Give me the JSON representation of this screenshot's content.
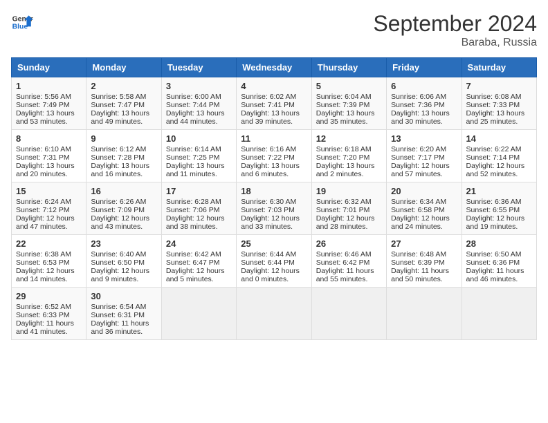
{
  "header": {
    "logo_line1": "General",
    "logo_line2": "Blue",
    "title": "September 2024",
    "subtitle": "Baraba, Russia"
  },
  "weekdays": [
    "Sunday",
    "Monday",
    "Tuesday",
    "Wednesday",
    "Thursday",
    "Friday",
    "Saturday"
  ],
  "weeks": [
    [
      {
        "day": "1",
        "lines": [
          "Sunrise: 5:56 AM",
          "Sunset: 7:49 PM",
          "Daylight: 13 hours",
          "and 53 minutes."
        ]
      },
      {
        "day": "2",
        "lines": [
          "Sunrise: 5:58 AM",
          "Sunset: 7:47 PM",
          "Daylight: 13 hours",
          "and 49 minutes."
        ]
      },
      {
        "day": "3",
        "lines": [
          "Sunrise: 6:00 AM",
          "Sunset: 7:44 PM",
          "Daylight: 13 hours",
          "and 44 minutes."
        ]
      },
      {
        "day": "4",
        "lines": [
          "Sunrise: 6:02 AM",
          "Sunset: 7:41 PM",
          "Daylight: 13 hours",
          "and 39 minutes."
        ]
      },
      {
        "day": "5",
        "lines": [
          "Sunrise: 6:04 AM",
          "Sunset: 7:39 PM",
          "Daylight: 13 hours",
          "and 35 minutes."
        ]
      },
      {
        "day": "6",
        "lines": [
          "Sunrise: 6:06 AM",
          "Sunset: 7:36 PM",
          "Daylight: 13 hours",
          "and 30 minutes."
        ]
      },
      {
        "day": "7",
        "lines": [
          "Sunrise: 6:08 AM",
          "Sunset: 7:33 PM",
          "Daylight: 13 hours",
          "and 25 minutes."
        ]
      }
    ],
    [
      {
        "day": "8",
        "lines": [
          "Sunrise: 6:10 AM",
          "Sunset: 7:31 PM",
          "Daylight: 13 hours",
          "and 20 minutes."
        ]
      },
      {
        "day": "9",
        "lines": [
          "Sunrise: 6:12 AM",
          "Sunset: 7:28 PM",
          "Daylight: 13 hours",
          "and 16 minutes."
        ]
      },
      {
        "day": "10",
        "lines": [
          "Sunrise: 6:14 AM",
          "Sunset: 7:25 PM",
          "Daylight: 13 hours",
          "and 11 minutes."
        ]
      },
      {
        "day": "11",
        "lines": [
          "Sunrise: 6:16 AM",
          "Sunset: 7:22 PM",
          "Daylight: 13 hours",
          "and 6 minutes."
        ]
      },
      {
        "day": "12",
        "lines": [
          "Sunrise: 6:18 AM",
          "Sunset: 7:20 PM",
          "Daylight: 13 hours",
          "and 2 minutes."
        ]
      },
      {
        "day": "13",
        "lines": [
          "Sunrise: 6:20 AM",
          "Sunset: 7:17 PM",
          "Daylight: 12 hours",
          "and 57 minutes."
        ]
      },
      {
        "day": "14",
        "lines": [
          "Sunrise: 6:22 AM",
          "Sunset: 7:14 PM",
          "Daylight: 12 hours",
          "and 52 minutes."
        ]
      }
    ],
    [
      {
        "day": "15",
        "lines": [
          "Sunrise: 6:24 AM",
          "Sunset: 7:12 PM",
          "Daylight: 12 hours",
          "and 47 minutes."
        ]
      },
      {
        "day": "16",
        "lines": [
          "Sunrise: 6:26 AM",
          "Sunset: 7:09 PM",
          "Daylight: 12 hours",
          "and 43 minutes."
        ]
      },
      {
        "day": "17",
        "lines": [
          "Sunrise: 6:28 AM",
          "Sunset: 7:06 PM",
          "Daylight: 12 hours",
          "and 38 minutes."
        ]
      },
      {
        "day": "18",
        "lines": [
          "Sunrise: 6:30 AM",
          "Sunset: 7:03 PM",
          "Daylight: 12 hours",
          "and 33 minutes."
        ]
      },
      {
        "day": "19",
        "lines": [
          "Sunrise: 6:32 AM",
          "Sunset: 7:01 PM",
          "Daylight: 12 hours",
          "and 28 minutes."
        ]
      },
      {
        "day": "20",
        "lines": [
          "Sunrise: 6:34 AM",
          "Sunset: 6:58 PM",
          "Daylight: 12 hours",
          "and 24 minutes."
        ]
      },
      {
        "day": "21",
        "lines": [
          "Sunrise: 6:36 AM",
          "Sunset: 6:55 PM",
          "Daylight: 12 hours",
          "and 19 minutes."
        ]
      }
    ],
    [
      {
        "day": "22",
        "lines": [
          "Sunrise: 6:38 AM",
          "Sunset: 6:53 PM",
          "Daylight: 12 hours",
          "and 14 minutes."
        ]
      },
      {
        "day": "23",
        "lines": [
          "Sunrise: 6:40 AM",
          "Sunset: 6:50 PM",
          "Daylight: 12 hours",
          "and 9 minutes."
        ]
      },
      {
        "day": "24",
        "lines": [
          "Sunrise: 6:42 AM",
          "Sunset: 6:47 PM",
          "Daylight: 12 hours",
          "and 5 minutes."
        ]
      },
      {
        "day": "25",
        "lines": [
          "Sunrise: 6:44 AM",
          "Sunset: 6:44 PM",
          "Daylight: 12 hours",
          "and 0 minutes."
        ]
      },
      {
        "day": "26",
        "lines": [
          "Sunrise: 6:46 AM",
          "Sunset: 6:42 PM",
          "Daylight: 11 hours",
          "and 55 minutes."
        ]
      },
      {
        "day": "27",
        "lines": [
          "Sunrise: 6:48 AM",
          "Sunset: 6:39 PM",
          "Daylight: 11 hours",
          "and 50 minutes."
        ]
      },
      {
        "day": "28",
        "lines": [
          "Sunrise: 6:50 AM",
          "Sunset: 6:36 PM",
          "Daylight: 11 hours",
          "and 46 minutes."
        ]
      }
    ],
    [
      {
        "day": "29",
        "lines": [
          "Sunrise: 6:52 AM",
          "Sunset: 6:33 PM",
          "Daylight: 11 hours",
          "and 41 minutes."
        ]
      },
      {
        "day": "30",
        "lines": [
          "Sunrise: 6:54 AM",
          "Sunset: 6:31 PM",
          "Daylight: 11 hours",
          "and 36 minutes."
        ]
      },
      {
        "day": "",
        "lines": []
      },
      {
        "day": "",
        "lines": []
      },
      {
        "day": "",
        "lines": []
      },
      {
        "day": "",
        "lines": []
      },
      {
        "day": "",
        "lines": []
      }
    ]
  ]
}
